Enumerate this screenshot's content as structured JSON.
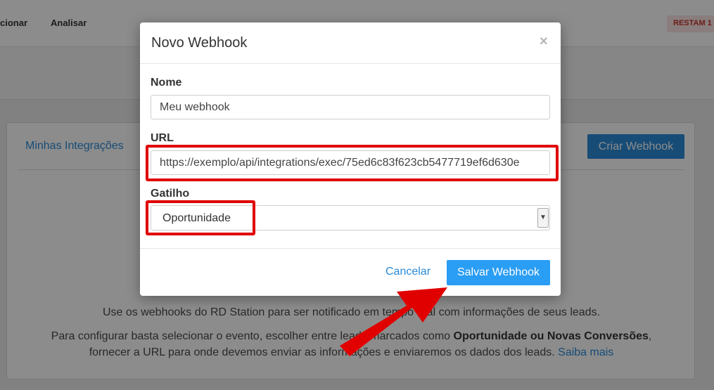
{
  "topnav": {
    "item_1": "cionar",
    "item_2": "Analisar",
    "badge": "RESTAM 1"
  },
  "panel": {
    "tab_label": "Minhas Integrações",
    "create_button": "Criar Webhook",
    "description": "Use os webhooks do RD Station para ser notificado em tempo real com informações de seus leads.",
    "config_text_1": "Para configurar basta selecionar o evento, escolher entre leads marcados como",
    "config_bold": "Oportunidade ou Novas Conversões",
    "config_text_2": "fornecer a URL para onde devemos enviar as informações e enviaremos os dados dos leads.",
    "learn_more": "Saiba mais"
  },
  "modal": {
    "title": "Novo Webhook",
    "close_symbol": "×",
    "name_label": "Nome",
    "name_value": "Meu webhook",
    "url_label": "URL",
    "url_value": "https://exemplo/api/integrations/exec/75ed6c83f623cb5477719ef6d630e",
    "trigger_label": "Gatilho",
    "trigger_value": "Oportunidade",
    "cancel_label": "Cancelar",
    "save_label": "Salvar Webhook"
  },
  "annotations": {
    "highlight_color": "#e00000",
    "arrow_color": "#e00000"
  }
}
